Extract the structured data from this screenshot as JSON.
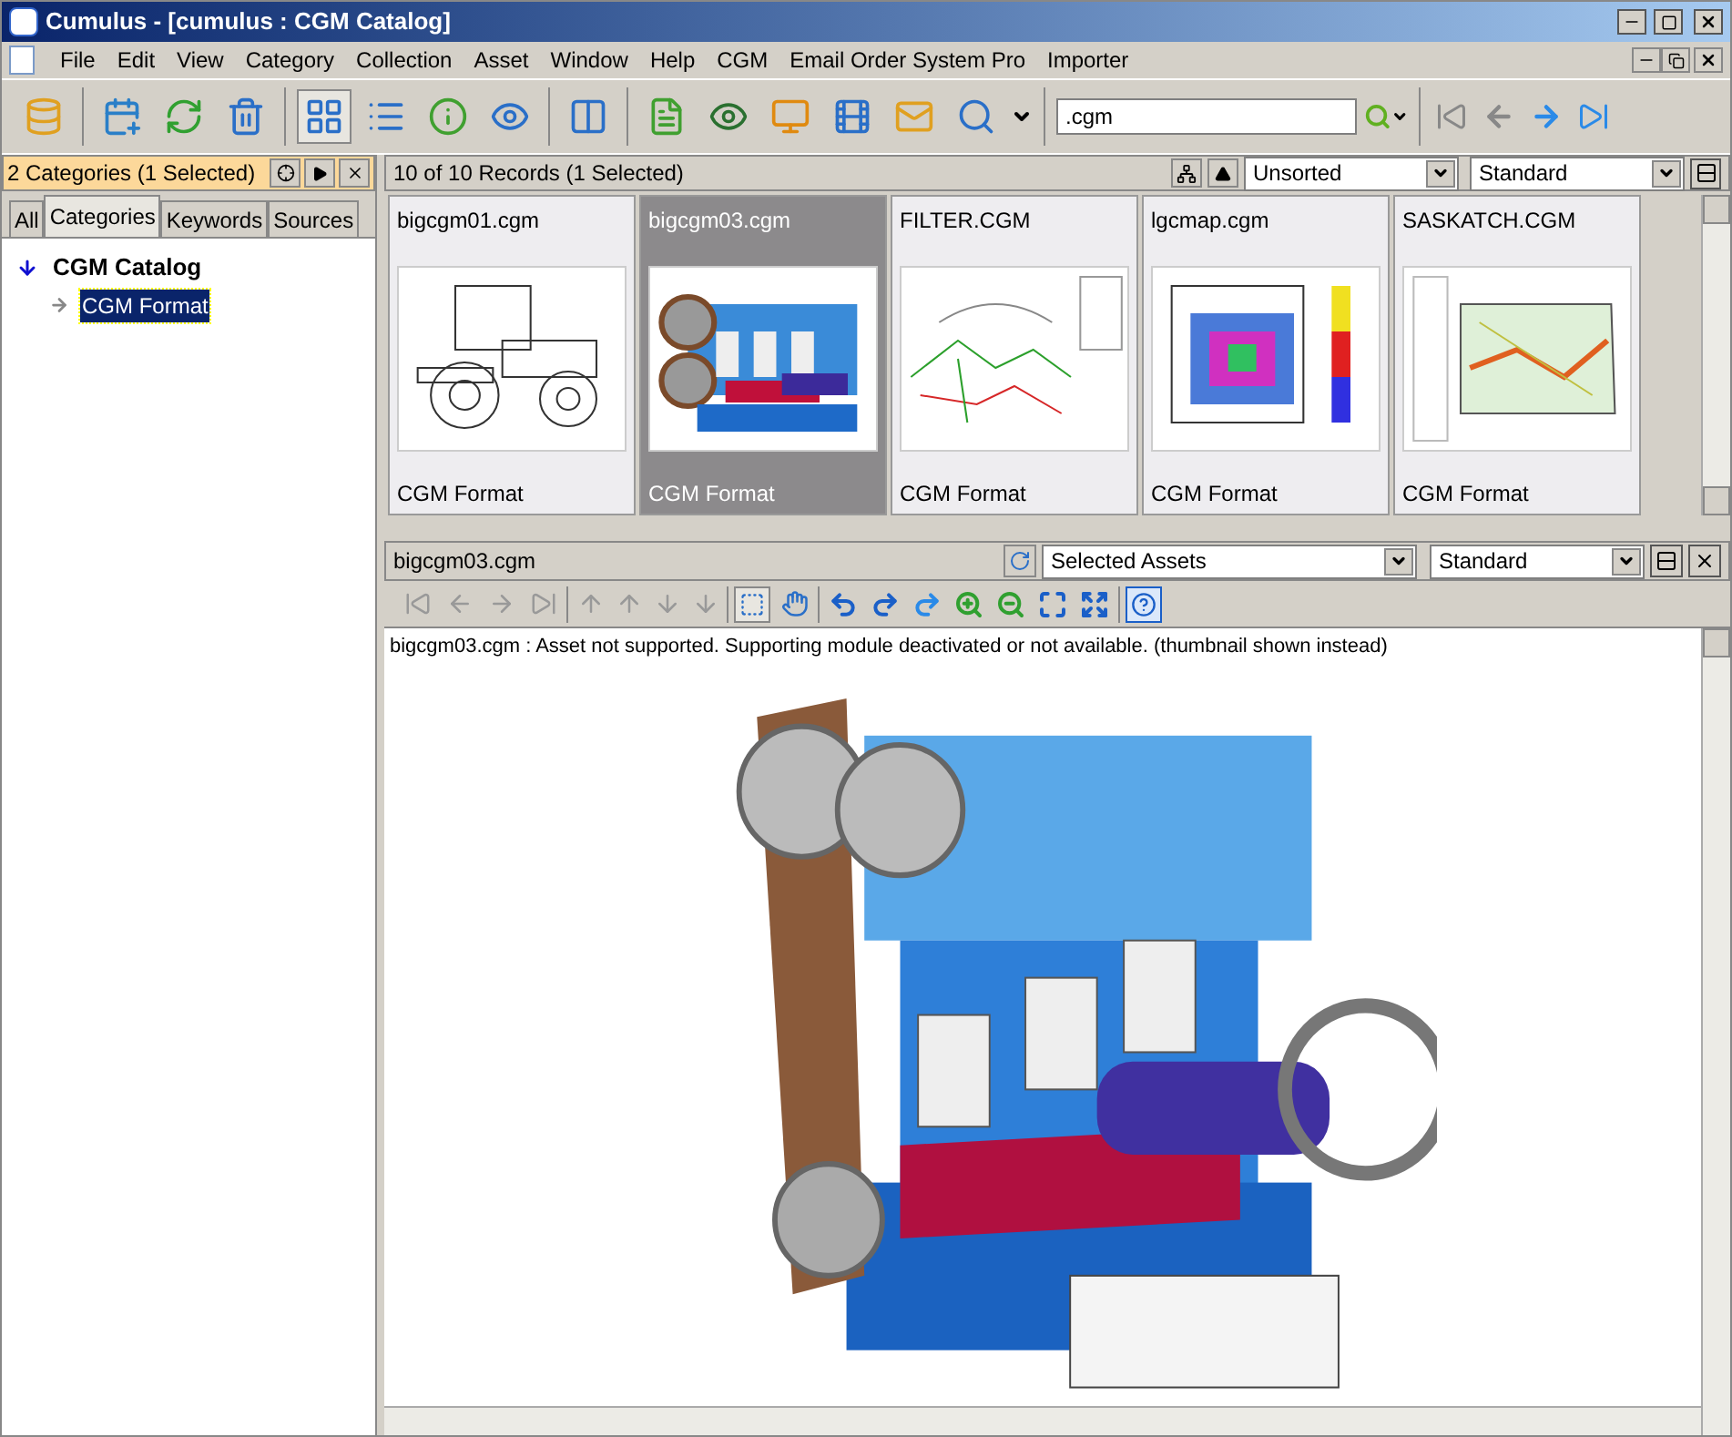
{
  "window": {
    "title": "Cumulus - [cumulus : CGM Catalog]"
  },
  "menu": [
    "File",
    "Edit",
    "View",
    "Category",
    "Collection",
    "Asset",
    "Window",
    "Help",
    "CGM",
    "Email Order System Pro",
    "Importer"
  ],
  "search": {
    "value": ".cgm"
  },
  "categories_panel": {
    "header": "2 Categories (1 Selected)",
    "tabs": [
      {
        "label": "All",
        "selected": false
      },
      {
        "label": "Categories",
        "selected": true
      },
      {
        "label": "Keywords",
        "selected": false
      },
      {
        "label": "Sources",
        "selected": false
      }
    ],
    "tree": [
      {
        "label": "CGM Catalog",
        "expanded": true,
        "selected": false,
        "children": [
          {
            "label": "CGM Format",
            "selected": true
          }
        ]
      }
    ]
  },
  "records": {
    "header": "10 of 10 Records (1 Selected)",
    "sort": "Unsorted",
    "view": "Standard",
    "assets": [
      {
        "name": "bigcgm01.cgm",
        "category": "CGM Format",
        "selected": false
      },
      {
        "name": "bigcgm03.cgm",
        "category": "CGM Format",
        "selected": true
      },
      {
        "name": "FILTER.CGM",
        "category": "CGM Format",
        "selected": false
      },
      {
        "name": "lgcmap.cgm",
        "category": "CGM Format",
        "selected": false
      },
      {
        "name": "SASKATCH.CGM",
        "category": "CGM Format",
        "selected": false
      }
    ]
  },
  "preview": {
    "file": "bigcgm03.cgm",
    "scope": "Selected Assets",
    "view": "Standard",
    "message": "bigcgm03.cgm : Asset not supported. Supporting module deactivated or not available. (thumbnail shown instead)"
  }
}
